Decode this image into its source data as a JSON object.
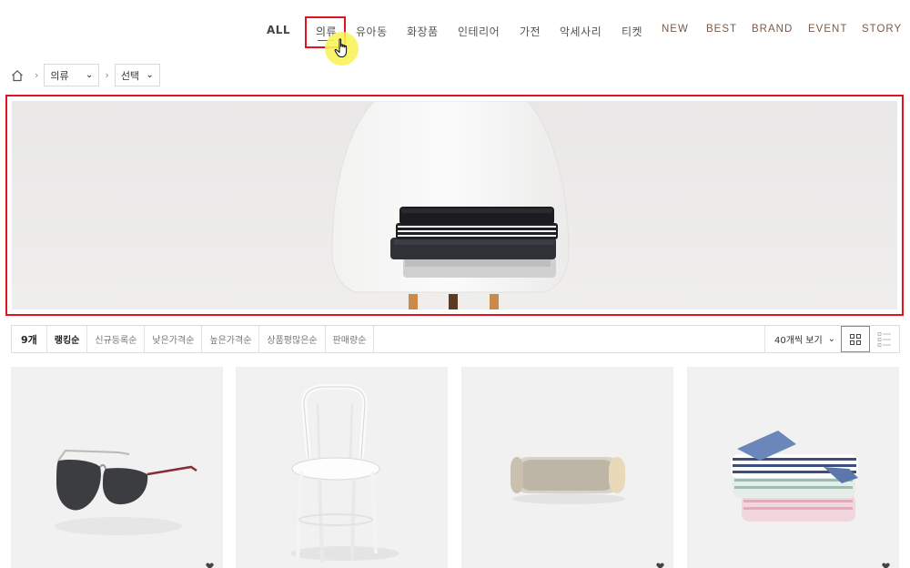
{
  "nav": {
    "items": [
      "ALL",
      "의류",
      "유아동",
      "화장품",
      "인테리어",
      "가전",
      "악세사리",
      "티켓",
      "NEW",
      "BEST",
      "BRAND",
      "EVENT",
      "STORY"
    ],
    "active_index": 1
  },
  "breadcrumb": {
    "category_select": "의류",
    "sub_select": "선택"
  },
  "sortbar": {
    "count": "9개",
    "options": [
      "랭킹순",
      "신규등록순",
      "낮은가격순",
      "높은가격순",
      "상품평많은순",
      "판매량순"
    ],
    "active_option": "랭킹순",
    "per_page": "40개씩 보기"
  },
  "products": [
    {
      "icon": "sunglasses"
    },
    {
      "icon": "chair"
    },
    {
      "icon": "speaker"
    },
    {
      "icon": "socks"
    }
  ],
  "colors": {
    "highlight_border": "#e0141e",
    "latin_nav": "#7a5a48",
    "cursor_highlight": "#f8f35a"
  }
}
